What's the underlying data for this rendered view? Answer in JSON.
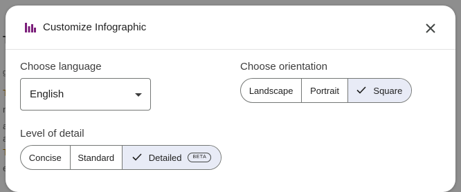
{
  "background": {
    "fragments": [
      "T",
      "g",
      "T",
      "n",
      "a",
      "a",
      "T",
      "e"
    ]
  },
  "dialog": {
    "title": "Customize Infographic",
    "icons": {
      "app": "infographic-icon",
      "close": "close-icon"
    },
    "language": {
      "label": "Choose language",
      "value": "English"
    },
    "orientation": {
      "label": "Choose orientation",
      "options": [
        "Landscape",
        "Portrait",
        "Square"
      ],
      "selected": "Square"
    },
    "detail": {
      "label": "Level of detail",
      "options": [
        "Concise",
        "Standard",
        "Detailed"
      ],
      "selected": "Detailed",
      "badge": "BETA"
    }
  },
  "colors": {
    "accent": "#7b1e7a",
    "selected_bg": "#e8ebf6",
    "outline": "#747775"
  }
}
